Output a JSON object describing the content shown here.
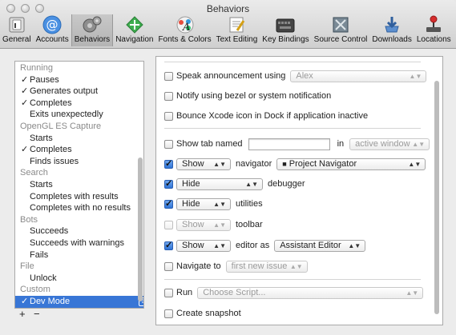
{
  "window": {
    "title": "Behaviors"
  },
  "toolbar": [
    {
      "label": "General",
      "icon": "switch-icon"
    },
    {
      "label": "Accounts",
      "icon": "at-icon"
    },
    {
      "label": "Behaviors",
      "icon": "gears-icon",
      "selected": true
    },
    {
      "label": "Navigation",
      "icon": "navigation-arrows-icon"
    },
    {
      "label": "Fonts & Colors",
      "icon": "font-palette-icon"
    },
    {
      "label": "Text Editing",
      "icon": "text-edit-icon"
    },
    {
      "label": "Key Bindings",
      "icon": "keyboard-icon"
    },
    {
      "label": "Source Control",
      "icon": "source-control-icon"
    },
    {
      "label": "Downloads",
      "icon": "download-icon"
    },
    {
      "label": "Locations",
      "icon": "joystick-icon"
    }
  ],
  "sidebar": {
    "rows": [
      {
        "type": "header",
        "label": "Running"
      },
      {
        "type": "item",
        "label": "Pauses",
        "checked": true
      },
      {
        "type": "item",
        "label": "Generates output",
        "checked": true
      },
      {
        "type": "item",
        "label": "Completes",
        "checked": true
      },
      {
        "type": "item",
        "label": "Exits unexpectedly",
        "checked": false
      },
      {
        "type": "header",
        "label": "OpenGL ES Capture"
      },
      {
        "type": "item",
        "label": "Starts",
        "checked": false
      },
      {
        "type": "item",
        "label": "Completes",
        "checked": true
      },
      {
        "type": "item",
        "label": "Finds issues",
        "checked": false
      },
      {
        "type": "header",
        "label": "Search"
      },
      {
        "type": "item",
        "label": "Starts",
        "checked": false
      },
      {
        "type": "item",
        "label": "Completes with results",
        "checked": false
      },
      {
        "type": "item",
        "label": "Completes with no results",
        "checked": false
      },
      {
        "type": "header",
        "label": "Bots"
      },
      {
        "type": "item",
        "label": "Succeeds",
        "checked": false
      },
      {
        "type": "item",
        "label": "Succeeds with warnings",
        "checked": false
      },
      {
        "type": "item",
        "label": "Fails",
        "checked": false
      },
      {
        "type": "header",
        "label": "File"
      },
      {
        "type": "item",
        "label": "Unlock",
        "checked": false
      },
      {
        "type": "header",
        "label": "Custom"
      },
      {
        "type": "item",
        "label": "Dev Mode",
        "checked": true,
        "selected": true,
        "badge": "⌘"
      }
    ],
    "add_label": "+",
    "remove_label": "−"
  },
  "check_glyph": "✓",
  "main": {
    "speak": {
      "label": "Speak announcement using",
      "voice": "Alex"
    },
    "notify": {
      "label": "Notify using bezel or system notification"
    },
    "bounce": {
      "label": "Bounce Xcode icon in Dock if application inactive"
    },
    "tab": {
      "label": "Show tab named",
      "name": "",
      "in_label": "in",
      "window": "active window"
    },
    "navigator": {
      "action": "Show",
      "label": "navigator",
      "value": "Project Navigator"
    },
    "debugger": {
      "action": "Hide",
      "label": "debugger"
    },
    "utilities": {
      "action": "Hide",
      "label": "utilities"
    },
    "toolbar": {
      "action": "Show",
      "label": "toolbar"
    },
    "editor": {
      "action": "Show",
      "label": "editor as",
      "value": "Assistant Editor"
    },
    "navigate": {
      "label": "Navigate to",
      "value": "first new issue"
    },
    "run": {
      "label": "Run",
      "placeholder": "Choose Script..."
    },
    "snapshot": {
      "label": "Create snapshot"
    }
  }
}
